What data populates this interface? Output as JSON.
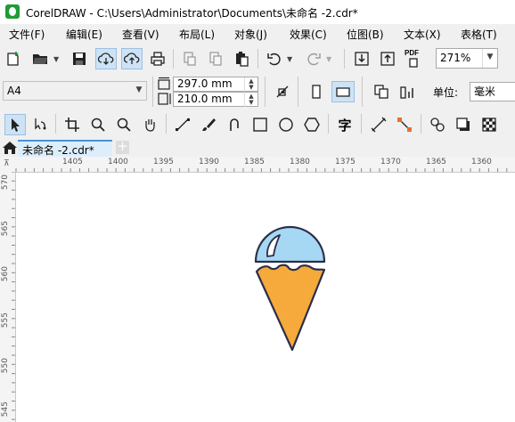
{
  "window": {
    "title": "CorelDRAW - C:\\Users\\Administrator\\Documents\\未命名 -2.cdr*"
  },
  "menu": [
    "文件(F)",
    "编辑(E)",
    "查看(V)",
    "布局(L)",
    "对象(J)",
    "效果(C)",
    "位图(B)",
    "文本(X)",
    "表格(T)"
  ],
  "standard_toolbar": {
    "zoom_value": "271%",
    "pdf_label": "PDF"
  },
  "property_bar": {
    "page_size": "A4",
    "width": "297.0 mm",
    "height": "210.0 mm",
    "units_label": "单位:",
    "units_value": "毫米"
  },
  "toolbox": {
    "text_tool_glyph": "字"
  },
  "tabs": {
    "document_tab": "未命名 -2.cdr*"
  },
  "rulers": {
    "horizontal": [
      "1405",
      "1400",
      "1395",
      "1390",
      "1385",
      "1380",
      "1375",
      "1370",
      "1365",
      "1360"
    ],
    "vertical": [
      "570",
      "565",
      "560",
      "555",
      "550",
      "545"
    ]
  },
  "colors": {
    "scoop": "#a6d8f4",
    "cone": "#f6aa3b",
    "outline": "#2b2e4a",
    "tab_accent": "#4a90d9",
    "app_logo": "#1f9b38"
  }
}
